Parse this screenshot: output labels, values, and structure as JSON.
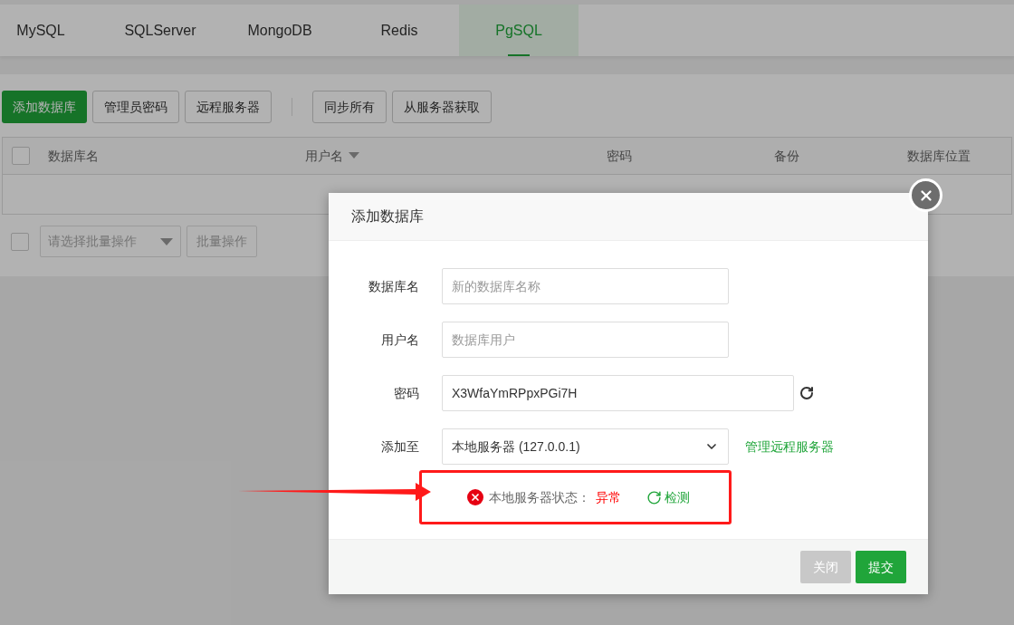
{
  "tabs": [
    {
      "label": "MySQL",
      "selected": false
    },
    {
      "label": "SQLServer",
      "selected": false
    },
    {
      "label": "MongoDB",
      "selected": false
    },
    {
      "label": "Redis",
      "selected": false
    },
    {
      "label": "PgSQL",
      "selected": true
    }
  ],
  "toolbar": [
    {
      "label": "添加数据库",
      "kind": "primary"
    },
    {
      "label": "管理员密码",
      "kind": "default"
    },
    {
      "label": "远程服务器",
      "kind": "default"
    },
    {
      "kind": "divider"
    },
    {
      "label": "同步所有",
      "kind": "default"
    },
    {
      "label": "从服务器获取",
      "kind": "default"
    }
  ],
  "table": {
    "columns": [
      {
        "label": "数据库名",
        "sortable": false
      },
      {
        "label": "用户名",
        "sortable": true
      },
      {
        "label": "密码",
        "sortable": false
      },
      {
        "label": "备份",
        "sortable": false
      },
      {
        "label": "数据库位置",
        "sortable": false
      }
    ],
    "select_all_checked": false
  },
  "batch": {
    "checked": false,
    "placeholder": "请选择批量操作",
    "button": "批量操作"
  },
  "dialog": {
    "title": "添加数据库",
    "fields": [
      {
        "kind": "input",
        "label": "数据库名",
        "placeholder": "新的数据库名称"
      },
      {
        "kind": "input",
        "label": "用户名",
        "placeholder": "数据库用户"
      },
      {
        "kind": "password",
        "label": "密码",
        "value": "X3WfaYmRPpxPGi7H"
      },
      {
        "kind": "select",
        "label": "添加至",
        "value": "本地服务器 (127.0.0.1)",
        "link": "管理远程服务器"
      }
    ],
    "status": {
      "label": "本地服务器状态：",
      "value": "异常",
      "ok": false,
      "check": "检测"
    },
    "buttons": [
      {
        "label": "关闭",
        "disabled": true
      },
      {
        "label": "提交",
        "disabled": false
      }
    ]
  }
}
